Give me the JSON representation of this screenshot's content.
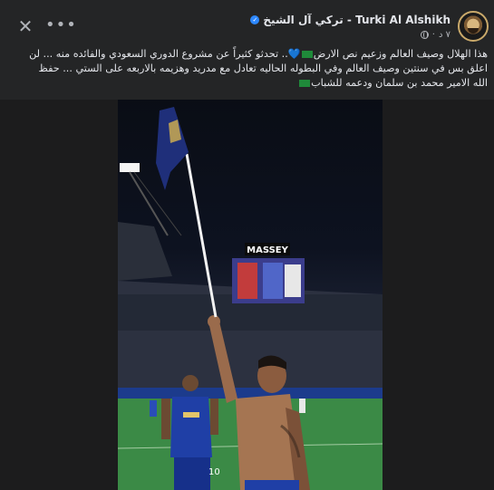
{
  "post": {
    "author_name": "تركي آل الشيخ - Turki Al Alshikh",
    "verified_mark": "✓",
    "time": "٧ د",
    "separator": "·",
    "close_glyph": "✕",
    "more_glyph": "•••",
    "text_line1_a": "هذا الهلال وصيف العالم وزعيم نص الارض",
    "text_line1_heart": "💙",
    "text_line1_b": ".. تحدثو كثيراً عن مشروع الدوري السعودي والفائده منه ... لن",
    "text_line2": "اعلق بس في سنتين وصيف العالم وفي البطوله الحاليه تعادل مع مدريد وهزيمه بالاربعه على الستي ... حفظ",
    "text_line3": "الله الامير محمد بن سلمان ودعمه للشباب",
    "colors": {
      "background": "#242526",
      "text": "#e4e6eb",
      "secondary": "#b0b3b8",
      "verified": "#2d88ff"
    }
  },
  "photo": {
    "scoreboard_text": "MASSEY",
    "jersey_number": "10"
  }
}
